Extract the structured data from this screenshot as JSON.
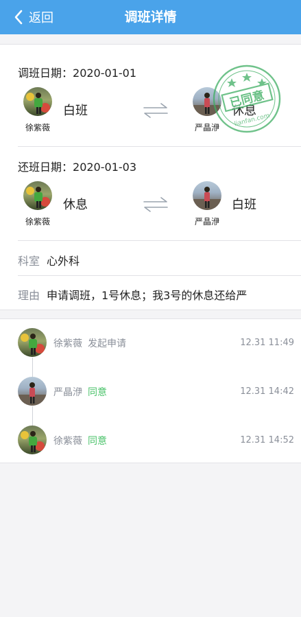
{
  "nav": {
    "back_label": "返回",
    "title": "调班详情"
  },
  "swap": {
    "label": "调班日期：",
    "date": "2020-01-01",
    "left": {
      "name": "徐紫薇",
      "shift": "白班"
    },
    "right": {
      "name": "严晶洢",
      "shift": "休息"
    }
  },
  "return": {
    "label": "还班日期：",
    "date": "2020-01-03",
    "left": {
      "name": "徐紫薇",
      "shift": "休息"
    },
    "right": {
      "name": "严晶洢",
      "shift": "白班"
    }
  },
  "department": {
    "label": "科室",
    "value": "心外科"
  },
  "reason": {
    "label": "理由",
    "value": "申请调班，1号休息；我3号的休息还给严"
  },
  "stamp": {
    "text": "已同意",
    "url": "lianfan.com"
  },
  "timeline": [
    {
      "name": "徐紫薇",
      "action": "发起申请",
      "time": "12.31 11:49"
    },
    {
      "name": "严晶洢",
      "action": "同意",
      "time": "12.31 14:42"
    },
    {
      "name": "徐紫薇",
      "action": "同意",
      "time": "12.31 14:52"
    }
  ],
  "colors": {
    "nav": "#4aa3ea",
    "agree": "#4cc36b",
    "stamp": "#3fae63"
  },
  "icons": [
    "chevron-left-icon",
    "swap-arrows-icon",
    "approved-stamp-icon"
  ]
}
